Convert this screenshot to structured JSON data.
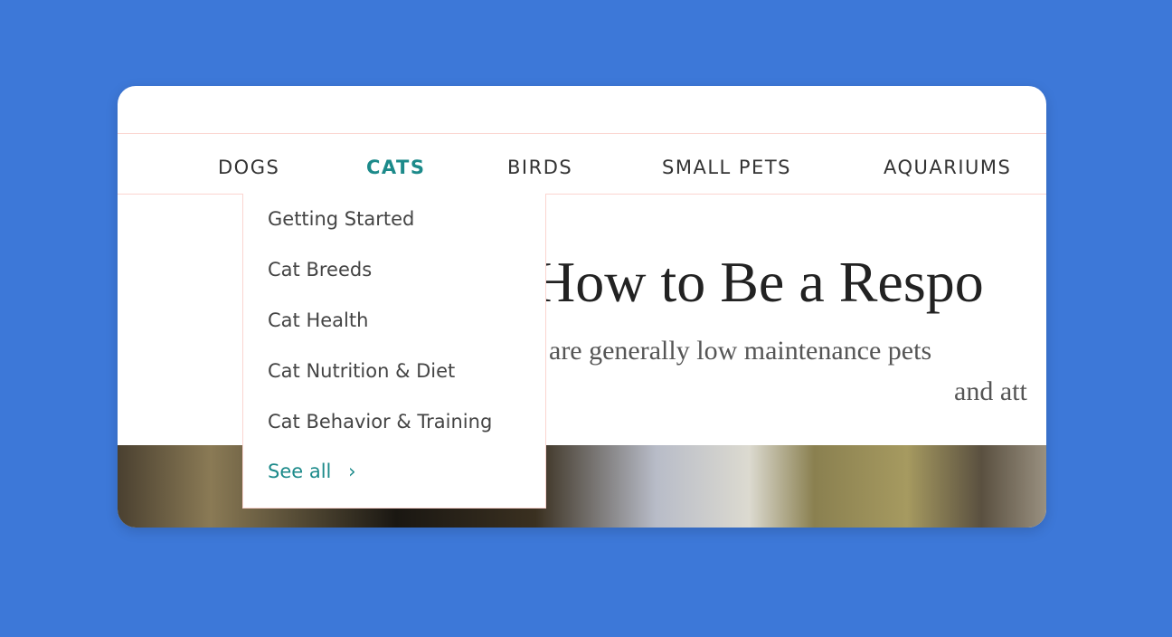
{
  "nav": {
    "items": [
      {
        "label": "DOGS"
      },
      {
        "label": "CATS",
        "active": true
      },
      {
        "label": "BIRDS"
      },
      {
        "label": "SMALL PETS"
      },
      {
        "label": "AQUARIUMS"
      }
    ]
  },
  "dropdown": {
    "items": [
      "Getting Started",
      "Cat Breeds",
      "Cat Health",
      "Cat Nutrition & Diet",
      "Cat Behavior & Training"
    ],
    "see_all": "See all",
    "see_all_icon": "chevron-right-icon"
  },
  "hero": {
    "title": "How to Be a Respo",
    "subtitle_line1": "are generally low maintenance pets",
    "subtitle_line2": "and att"
  },
  "colors": {
    "accent": "#1c8a8a",
    "background": "#3d78d8",
    "border": "#fbd5d0"
  }
}
